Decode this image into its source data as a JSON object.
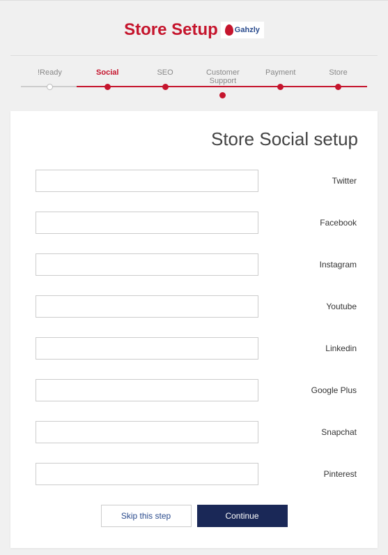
{
  "header": {
    "title": "Store Setup",
    "logo_text": "Gahzly"
  },
  "stepper": {
    "steps": [
      {
        "label": "!Ready",
        "state": "inactive"
      },
      {
        "label": "Social",
        "state": "active"
      },
      {
        "label": "SEO",
        "state": "upcoming"
      },
      {
        "label": "Customer Support",
        "state": "upcoming"
      },
      {
        "label": "Payment",
        "state": "upcoming"
      },
      {
        "label": "Store",
        "state": "upcoming"
      }
    ]
  },
  "form": {
    "title": "Store Social setup",
    "fields": [
      {
        "label": "Twitter",
        "value": ""
      },
      {
        "label": "Facebook",
        "value": ""
      },
      {
        "label": "Instagram",
        "value": ""
      },
      {
        "label": "Youtube",
        "value": ""
      },
      {
        "label": "Linkedin",
        "value": ""
      },
      {
        "label": "Google Plus",
        "value": ""
      },
      {
        "label": "Snapchat",
        "value": ""
      },
      {
        "label": "Pinterest",
        "value": ""
      }
    ]
  },
  "buttons": {
    "skip": "Skip this step",
    "continue": "Continue"
  }
}
